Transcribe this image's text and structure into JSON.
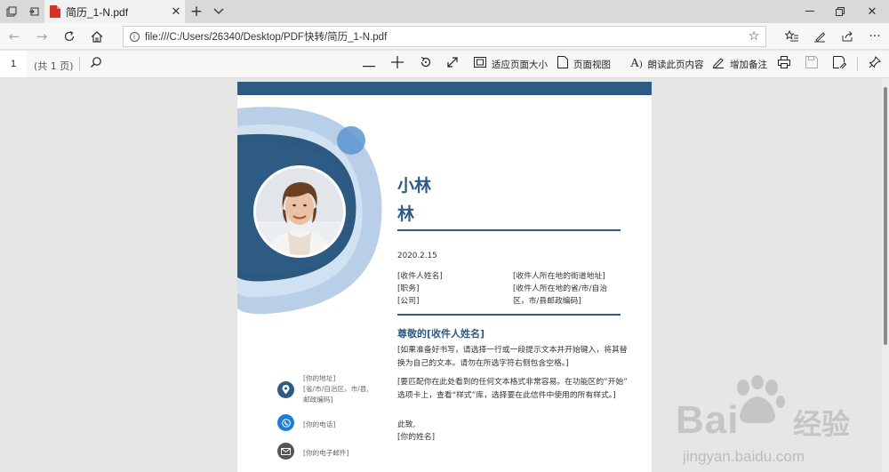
{
  "browser": {
    "tab": {
      "title": "简历_1-N.pdf"
    },
    "address": {
      "url": "file:///C:/Users/26340/Desktop/PDF快转/简历_1-N.pdf"
    },
    "colors": {
      "accent": "#2e5b84",
      "pdf_red": "#d93025"
    }
  },
  "pdf_toolbar": {
    "page_number": "1",
    "page_count": "(共 1 页)",
    "fit_page_label": "适应页面大小",
    "page_view_label": "页面视图",
    "read_aloud_label": "朗读此页内容",
    "add_note_label": "增加备注"
  },
  "document": {
    "name_line1": "小林",
    "name_line2": "林",
    "date": "2020.2.15",
    "recipient_left": [
      "[收件人姓名]",
      "[职务]",
      "[公司]"
    ],
    "recipient_right": [
      "[收件人所在地的街道地址]",
      "[收件人所在地的省/市/自治",
      "区，市/县邮政编码]"
    ],
    "salutation": "尊敬的[收件人姓名]",
    "paragraph1": [
      "[如果准备好书写，请选择一行或一段提示文本并开始键入，将其替",
      "换为自己的文本。请勿在所选字符右侧包含空格。]"
    ],
    "paragraph2": [
      "[要匹配你在此处看到的任何文本格式非常容易。在功能区的“开始”",
      "选项卡上，查看“样式”库，选择要在此信件中使用的所有样式。]"
    ],
    "closing": "此致,",
    "signature": "[你的姓名]",
    "contacts": {
      "address": [
        "[你的地址]",
        "[省/市/自治区，市/县,",
        "邮政编码]"
      ],
      "phone": "[你的电话]",
      "email": "[你的电子邮件]"
    }
  },
  "watermark": {
    "brand": "Bai",
    "brand_cn": "经验",
    "url": "jingyan.baidu.com"
  }
}
